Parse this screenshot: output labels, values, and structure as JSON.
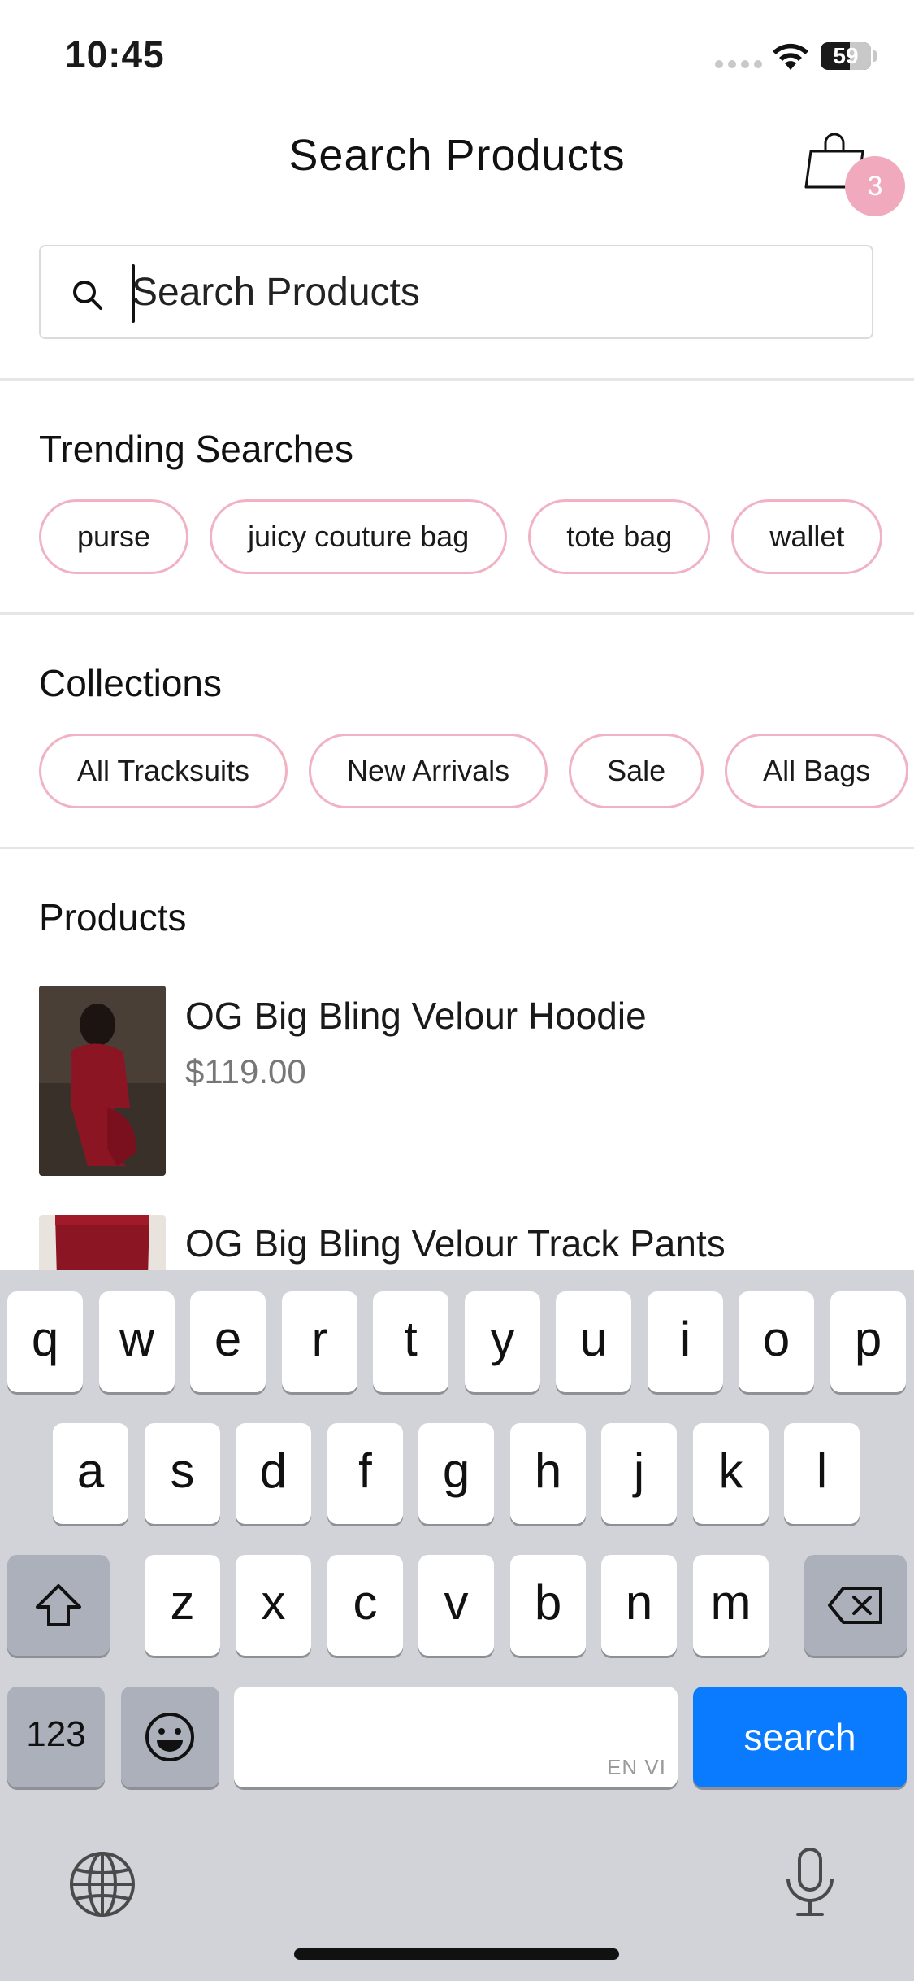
{
  "status_bar": {
    "time": "10:45",
    "battery": "59"
  },
  "header": {
    "title": "Search Products",
    "cart_count": "3"
  },
  "search": {
    "placeholder": "Search Products",
    "value": ""
  },
  "trending": {
    "title": "Trending Searches",
    "chips": [
      "purse",
      "juicy couture bag",
      "tote bag",
      "wallet"
    ]
  },
  "collections": {
    "title": "Collections",
    "chips": [
      "All Tracksuits",
      "New Arrivals",
      "Sale",
      "All Bags"
    ]
  },
  "products": {
    "title": "Products",
    "items": [
      {
        "name": "OG Big Bling Velour Hoodie",
        "price": "$119.00"
      },
      {
        "name": "OG Big Bling Velour Track Pants",
        "price": ""
      }
    ]
  },
  "keyboard": {
    "row1": [
      "q",
      "w",
      "e",
      "r",
      "t",
      "y",
      "u",
      "i",
      "o",
      "p"
    ],
    "row2": [
      "a",
      "s",
      "d",
      "f",
      "g",
      "h",
      "j",
      "k",
      "l"
    ],
    "row3": [
      "z",
      "x",
      "c",
      "v",
      "b",
      "n",
      "m"
    ],
    "numbers_label": "123",
    "space_sublabel": "EN VI",
    "action_label": "search"
  },
  "colors": {
    "accent_pink": "#f1b3c4",
    "badge_pink": "#f1aabd",
    "keyboard_blue": "#0a7aff"
  }
}
